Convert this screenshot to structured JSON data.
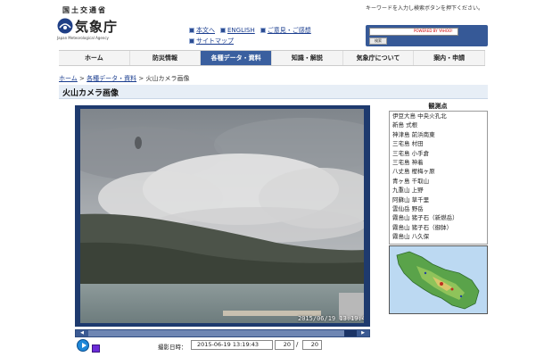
{
  "header": {
    "ministry": "国土交通省",
    "agency": "気象庁",
    "agency_en": "Japan Meteorological Agency"
  },
  "toplinks": {
    "text_version": "本文へ",
    "english": "ENGLISH",
    "opinions": "ご意見・ご感想",
    "sitemap": "サイトマップ"
  },
  "search": {
    "instruction": "キーワードを入力し検索ボタンを押下ください。",
    "powered": "POWERED BY YAHOO!",
    "button": "検索"
  },
  "nav": [
    "ホーム",
    "防災情報",
    "各種データ・資料",
    "知識・解説",
    "気象庁について",
    "案内・申請"
  ],
  "nav_active_index": 2,
  "breadcrumb": {
    "home": "ホーム",
    "sep1": " > ",
    "data": "各種データ・資料",
    "sep2": " > ",
    "current": "火山カメラ画像"
  },
  "page_title": "火山カメラ画像",
  "camera": {
    "timestamp": "2015/06/19  13:19:43"
  },
  "controls": {
    "time_label": "撮影日時：",
    "time_value": "2015-06-19  13:19:43",
    "frame_current": "20",
    "frame_separator": "/",
    "frame_total": "20"
  },
  "stations": {
    "title": "観測点",
    "items": [
      "伊豆大島 中央火孔北",
      "新島 式根",
      "神津島 前浜南東",
      "三宅島 村田",
      "三宅島 小手倉",
      "三宅島 神着",
      "八丈島 樫梅ヶ原",
      "青ヶ島 千取山",
      "九重山 上野",
      "阿蘇山 草千里",
      "雲仙岳 野岳",
      "霧島山 猪子石（新燃岳）",
      "霧島山 猪子石（御鉢）",
      "霧島山 八久保"
    ]
  },
  "colors": {
    "nav_active": "#3a5f9f",
    "frame": "#1e3a6e",
    "link": "#1a3d8f"
  }
}
